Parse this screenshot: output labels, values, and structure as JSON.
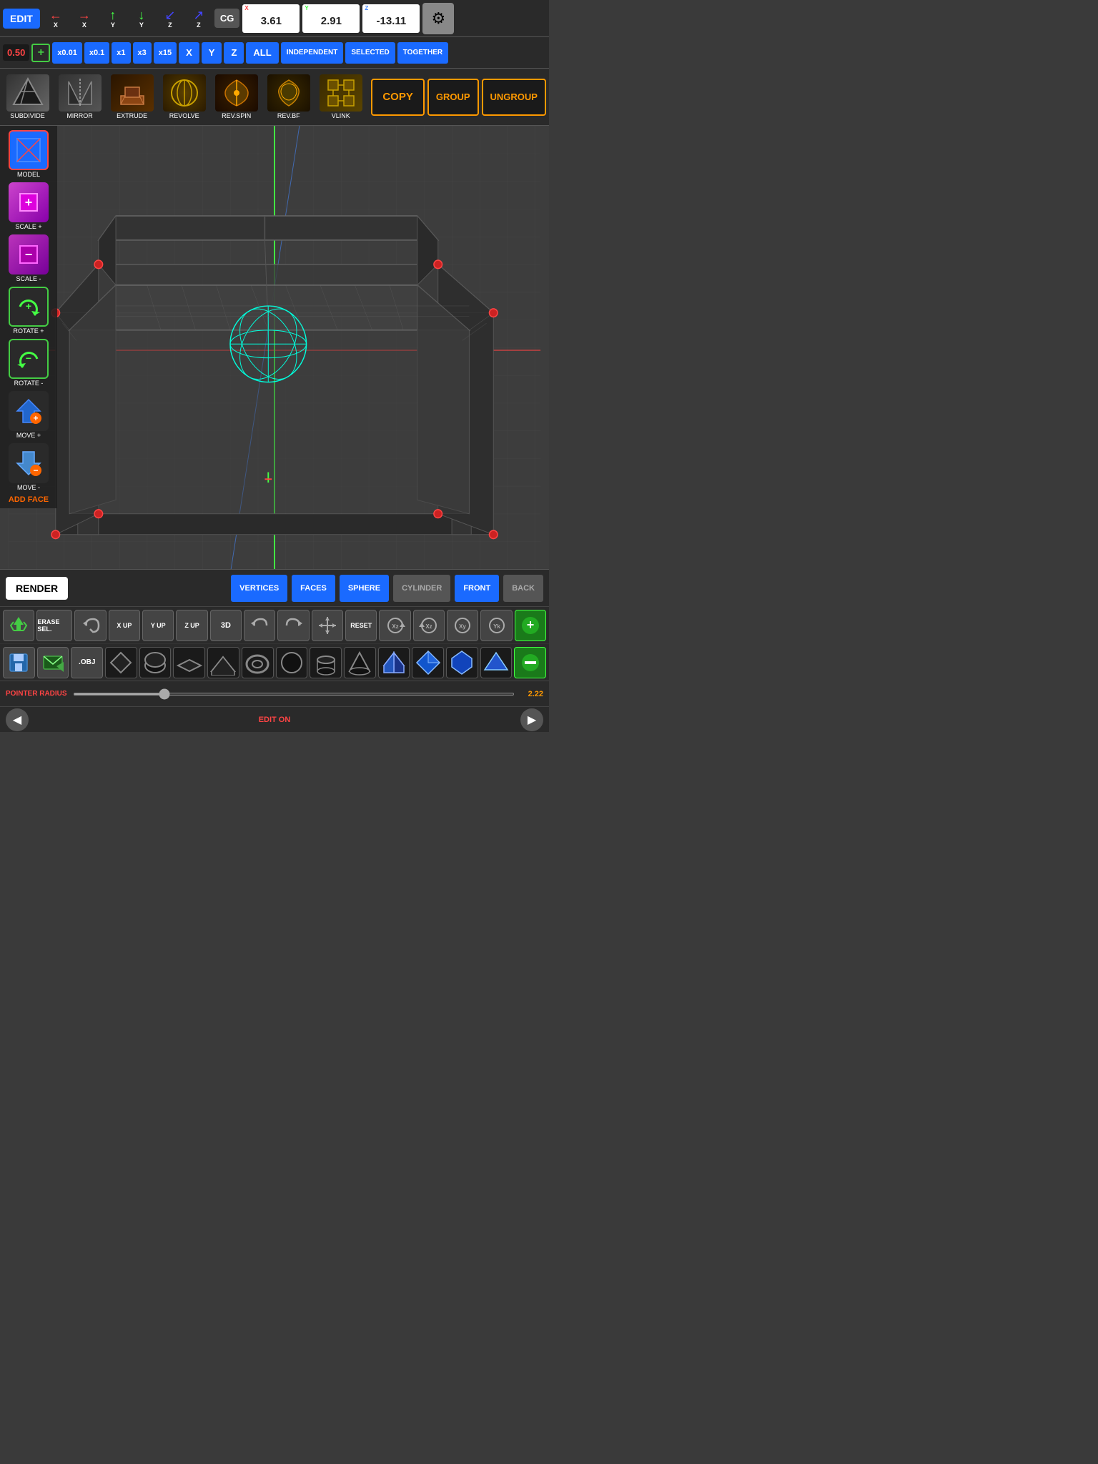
{
  "toolbar": {
    "edit_label": "EDIT",
    "cg_label": "CG",
    "coord_x": "3.61",
    "coord_y": "2.91",
    "coord_z": "-13.11",
    "gear_icon": "⚙"
  },
  "scale_toolbar": {
    "counter": "0.50",
    "plus_label": "+",
    "scales": [
      "x0.01",
      "x0.1",
      "x1",
      "x3",
      "x15"
    ],
    "axes": [
      "X",
      "Y",
      "Z",
      "ALL"
    ],
    "modes": [
      "INDEPENDENT",
      "SELECTED",
      "TOGETHER"
    ]
  },
  "operations": {
    "items": [
      {
        "label": "SUBDIVIDE",
        "icon": "◆"
      },
      {
        "label": "MIRROR",
        "icon": "▽"
      },
      {
        "label": "EXTRUDE",
        "icon": "▲"
      },
      {
        "label": "REVOLVE",
        "icon": "◉"
      },
      {
        "label": "REV.SPIN",
        "icon": "✦"
      },
      {
        "label": "REV.BF",
        "icon": "❋"
      },
      {
        "label": "VLINK",
        "icon": "⬡"
      }
    ],
    "copy_label": "COPY",
    "group_label": "GROUP",
    "ungroup_label": "UNGROUP"
  },
  "left_tools": [
    {
      "label": "MODEL",
      "type": "model"
    },
    {
      "label": "SCALE +",
      "type": "scale-plus"
    },
    {
      "label": "SCALE -",
      "type": "scale-minus"
    },
    {
      "label": "ROTATE +",
      "type": "rotate-plus"
    },
    {
      "label": "ROTATE -",
      "type": "rotate-minus"
    },
    {
      "label": "MOVE +",
      "type": "move-plus"
    },
    {
      "label": "MOVE -",
      "type": "move-minus"
    },
    {
      "label": "ADD FACE",
      "type": "add-face"
    }
  ],
  "bottom": {
    "render_label": "RENDER",
    "view_buttons": [
      "VERTICES",
      "FACES",
      "SPHERE",
      "CYLINDER",
      "FRONT",
      "BACK"
    ],
    "active_views": [
      1,
      1,
      1,
      0,
      1,
      0
    ],
    "tools": [
      "ERASE SEL.",
      "↩",
      "X UP",
      "Y UP",
      "Z UP",
      "3D",
      "↺",
      "↻",
      "⊞",
      "RESET"
    ],
    "pointer_radius_label": "POINTER RADIUS",
    "pointer_radius_val": "2.22",
    "edit_on_label": "EDIT ON"
  }
}
